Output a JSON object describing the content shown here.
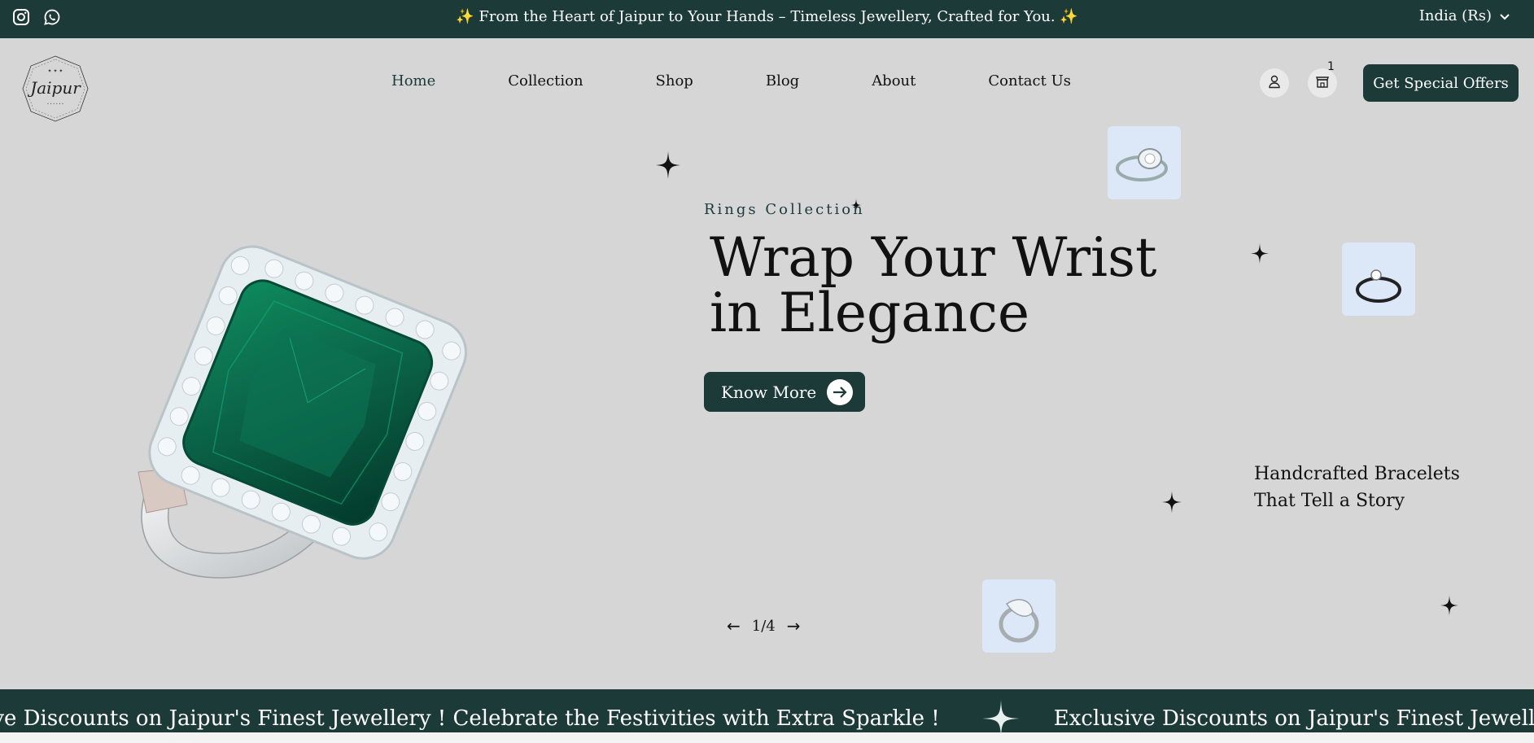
{
  "topbar": {
    "announcement": "✨ From the Heart of Jaipur to Your Hands – Timeless Jewellery, Crafted for You. ✨",
    "region": "India (Rs)",
    "icons": [
      "instagram-icon",
      "whatsapp-icon",
      "chevron-down-icon"
    ]
  },
  "header": {
    "logo_text": "Jaipur",
    "nav": [
      {
        "label": "Home",
        "active": true
      },
      {
        "label": "Collection"
      },
      {
        "label": "Shop"
      },
      {
        "label": "Blog"
      },
      {
        "label": "About"
      },
      {
        "label": "Contact Us"
      }
    ],
    "cart_count": "1",
    "offers_button": "Get Special Offers"
  },
  "hero": {
    "eyebrow": "Rings Collection",
    "headline_line1": "Wrap Your Wrist",
    "headline_line2": "in Elegance",
    "cta": "Know More",
    "side_line1": "Handcrafted Bracelets",
    "side_line2": "That Tell a Story",
    "pager": "1/4"
  },
  "marquee": {
    "text_a": "ive Discounts on Jaipur's Finest Jewellery ! Celebrate the Festivities with Extra Sparkle !",
    "text_b": "Exclusive Discounts on Jaipur's Finest Jewellery ! Celebrate"
  },
  "colors": {
    "brand_dark": "#1c3a38",
    "page_bg": "#d6d6d6",
    "thumb_bg": "#dce8f8",
    "emerald": "#0d6b4e"
  }
}
